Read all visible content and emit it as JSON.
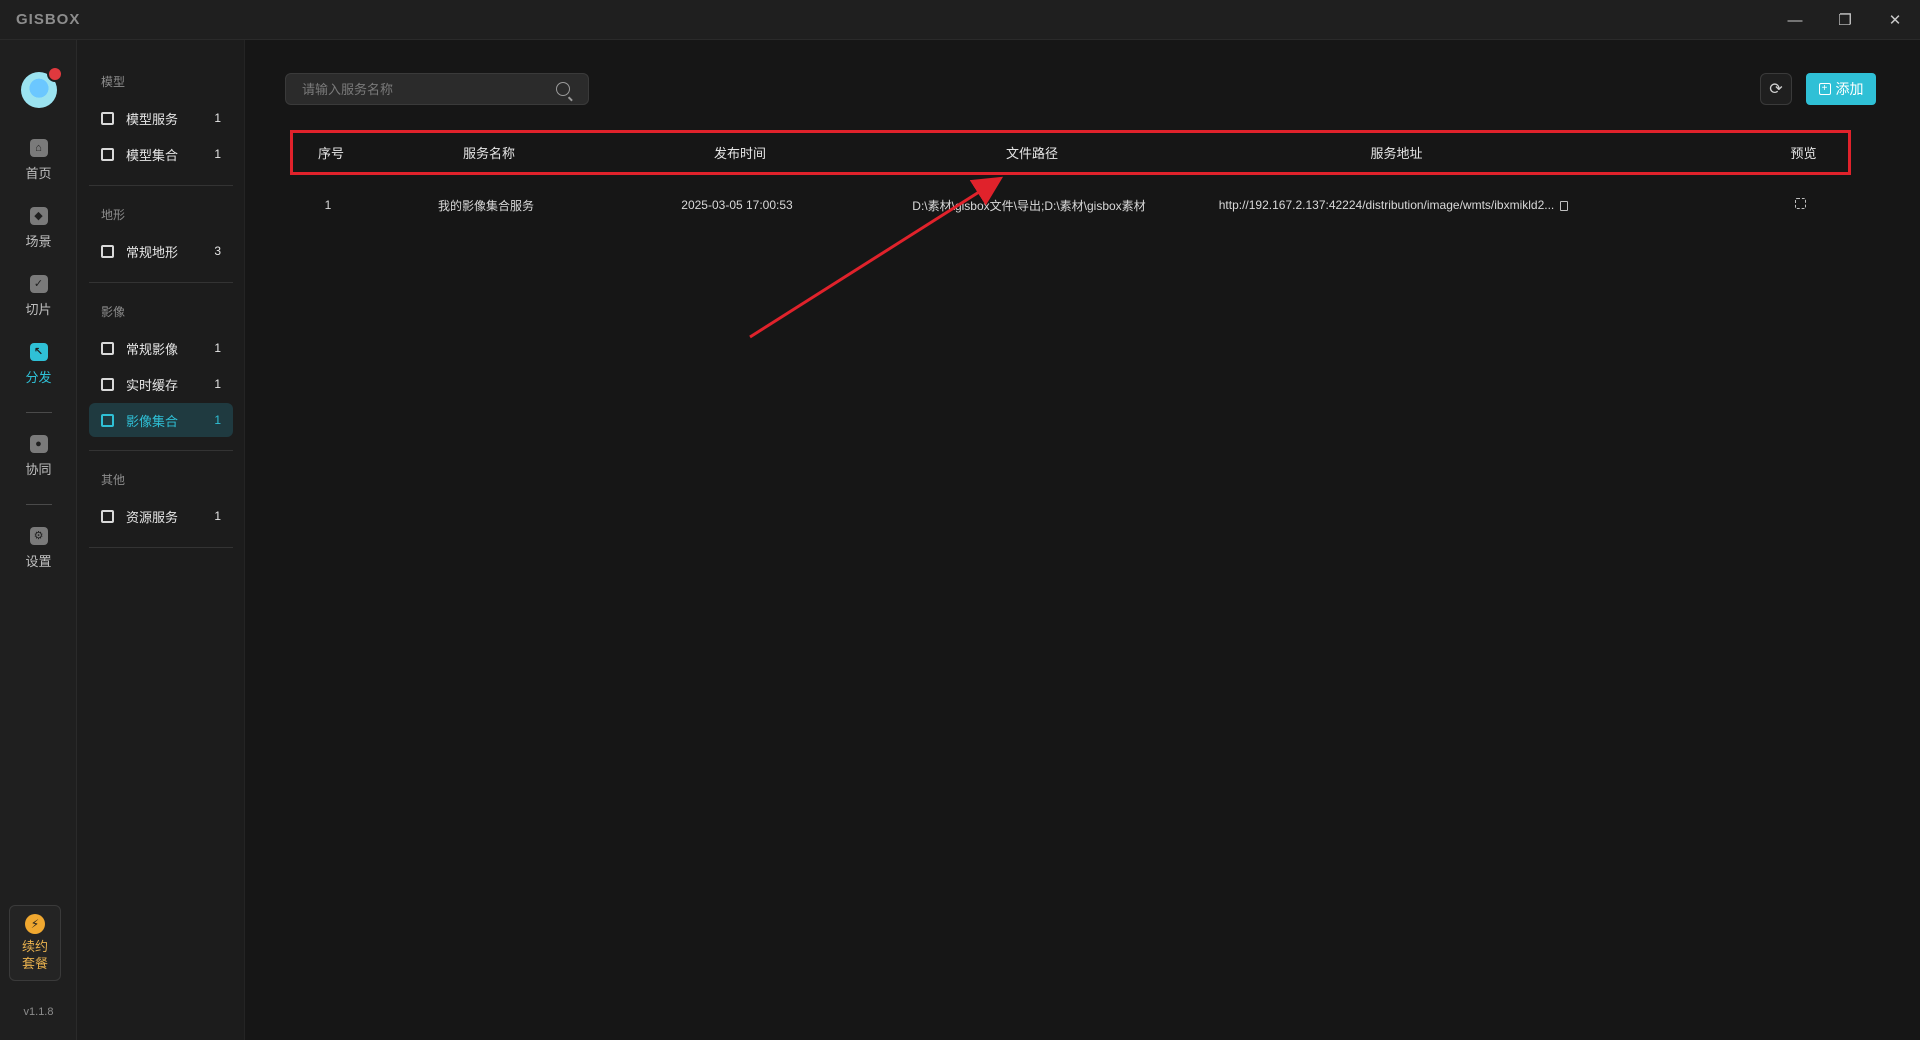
{
  "app": {
    "logo": "GISBOX"
  },
  "window_controls": {
    "minimize": "—",
    "restore": "❐",
    "close": "✕"
  },
  "rail": {
    "items": [
      {
        "label": "首页",
        "icon": "home-icon"
      },
      {
        "label": "场景",
        "icon": "scene-icon"
      },
      {
        "label": "切片",
        "icon": "slice-icon"
      },
      {
        "label": "分发",
        "icon": "distribute-icon",
        "active": true
      },
      {
        "label": "协同",
        "icon": "lock-icon"
      },
      {
        "label": "设置",
        "icon": "gear-icon"
      }
    ],
    "renew_line1": "续约",
    "renew_line2": "套餐",
    "version": "v1.1.8"
  },
  "categories": {
    "model_heading": "模型",
    "model_service": {
      "label": "模型服务",
      "count": "1"
    },
    "model_collection": {
      "label": "模型集合",
      "count": "1"
    },
    "terrain_heading": "地形",
    "terrain_regular": {
      "label": "常规地形",
      "count": "3"
    },
    "imagery_heading": "影像",
    "imagery_regular": {
      "label": "常规影像",
      "count": "1"
    },
    "imagery_cache": {
      "label": "实时缓存",
      "count": "1"
    },
    "imagery_collection": {
      "label": "影像集合",
      "count": "1"
    },
    "other_heading": "其他",
    "resource_service": {
      "label": "资源服务",
      "count": "1"
    }
  },
  "toolbar": {
    "search_placeholder": "请输入服务名称",
    "add_label": "添加"
  },
  "table": {
    "columns": [
      "序号",
      "服务名称",
      "发布时间",
      "文件路径",
      "服务地址",
      "预览"
    ],
    "rows": [
      {
        "index": "1",
        "name": "我的影像集合服务",
        "time": "2025-03-05 17:00:53",
        "path": "D:\\素材\\gisbox文件\\导出;D:\\素材\\gisbox素材",
        "url": "http://192.167.2.137:42224/distribution/image/wmts/ibxmikld2..."
      }
    ]
  },
  "colors": {
    "accent": "#2fc0d6",
    "highlight": "#e0222b",
    "renew": "#f0a830"
  }
}
